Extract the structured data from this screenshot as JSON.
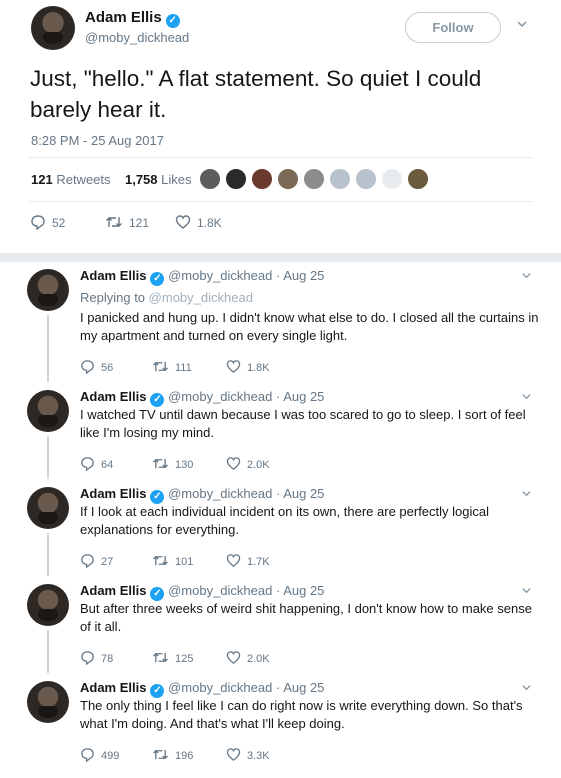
{
  "main": {
    "name": "Adam Ellis",
    "handle": "@moby_dickhead",
    "follow_label": "Follow",
    "text": "Just, \"hello.\" A flat statement. So quiet I could barely hear it.",
    "timestamp": "8:28 PM - 25 Aug 2017",
    "retweets_count": "121",
    "retweets_label": "Retweets",
    "likes_count": "1,758",
    "likes_label": "Likes",
    "replies": "52",
    "retweets": "121",
    "likes": "1.8K"
  },
  "replies": [
    {
      "name": "Adam Ellis",
      "handle": "@moby_dickhead",
      "date": "Aug 25",
      "replying_prefix": "Replying to",
      "replying_to": "@moby_dickhead",
      "text": "I panicked and hung up. I didn't know what else to do. I closed all the curtains in my apartment and turned on every single light.",
      "replies": "56",
      "retweets": "111",
      "likes": "1.8K"
    },
    {
      "name": "Adam Ellis",
      "handle": "@moby_dickhead",
      "date": "Aug 25",
      "text": "I watched TV until dawn because I was too scared to go to sleep. I sort of feel like I'm losing my mind.",
      "replies": "64",
      "retweets": "130",
      "likes": "2.0K"
    },
    {
      "name": "Adam Ellis",
      "handle": "@moby_dickhead",
      "date": "Aug 25",
      "text": "If I look at each individual incident on its own, there are perfectly logical explanations for everything.",
      "replies": "27",
      "retweets": "101",
      "likes": "1.7K"
    },
    {
      "name": "Adam Ellis",
      "handle": "@moby_dickhead",
      "date": "Aug 25",
      "text": "But after three weeks of weird shit happening, I don't know how to make sense of it all.",
      "replies": "78",
      "retweets": "125",
      "likes": "2.0K"
    },
    {
      "name": "Adam Ellis",
      "handle": "@moby_dickhead",
      "date": "Aug 25",
      "text": "The only thing I feel like I can do right now is write everything down. So that's what I'm doing. And that's what I'll keep doing.",
      "replies": "499",
      "retweets": "196",
      "likes": "3.3K"
    }
  ],
  "colors": {
    "verified": "#1da1f2",
    "text_secondary": "#657786",
    "separator": "#e6ecf0"
  },
  "icons": [
    "verified-icon",
    "chevron-down-icon",
    "reply-icon",
    "retweet-icon",
    "heart-icon"
  ]
}
